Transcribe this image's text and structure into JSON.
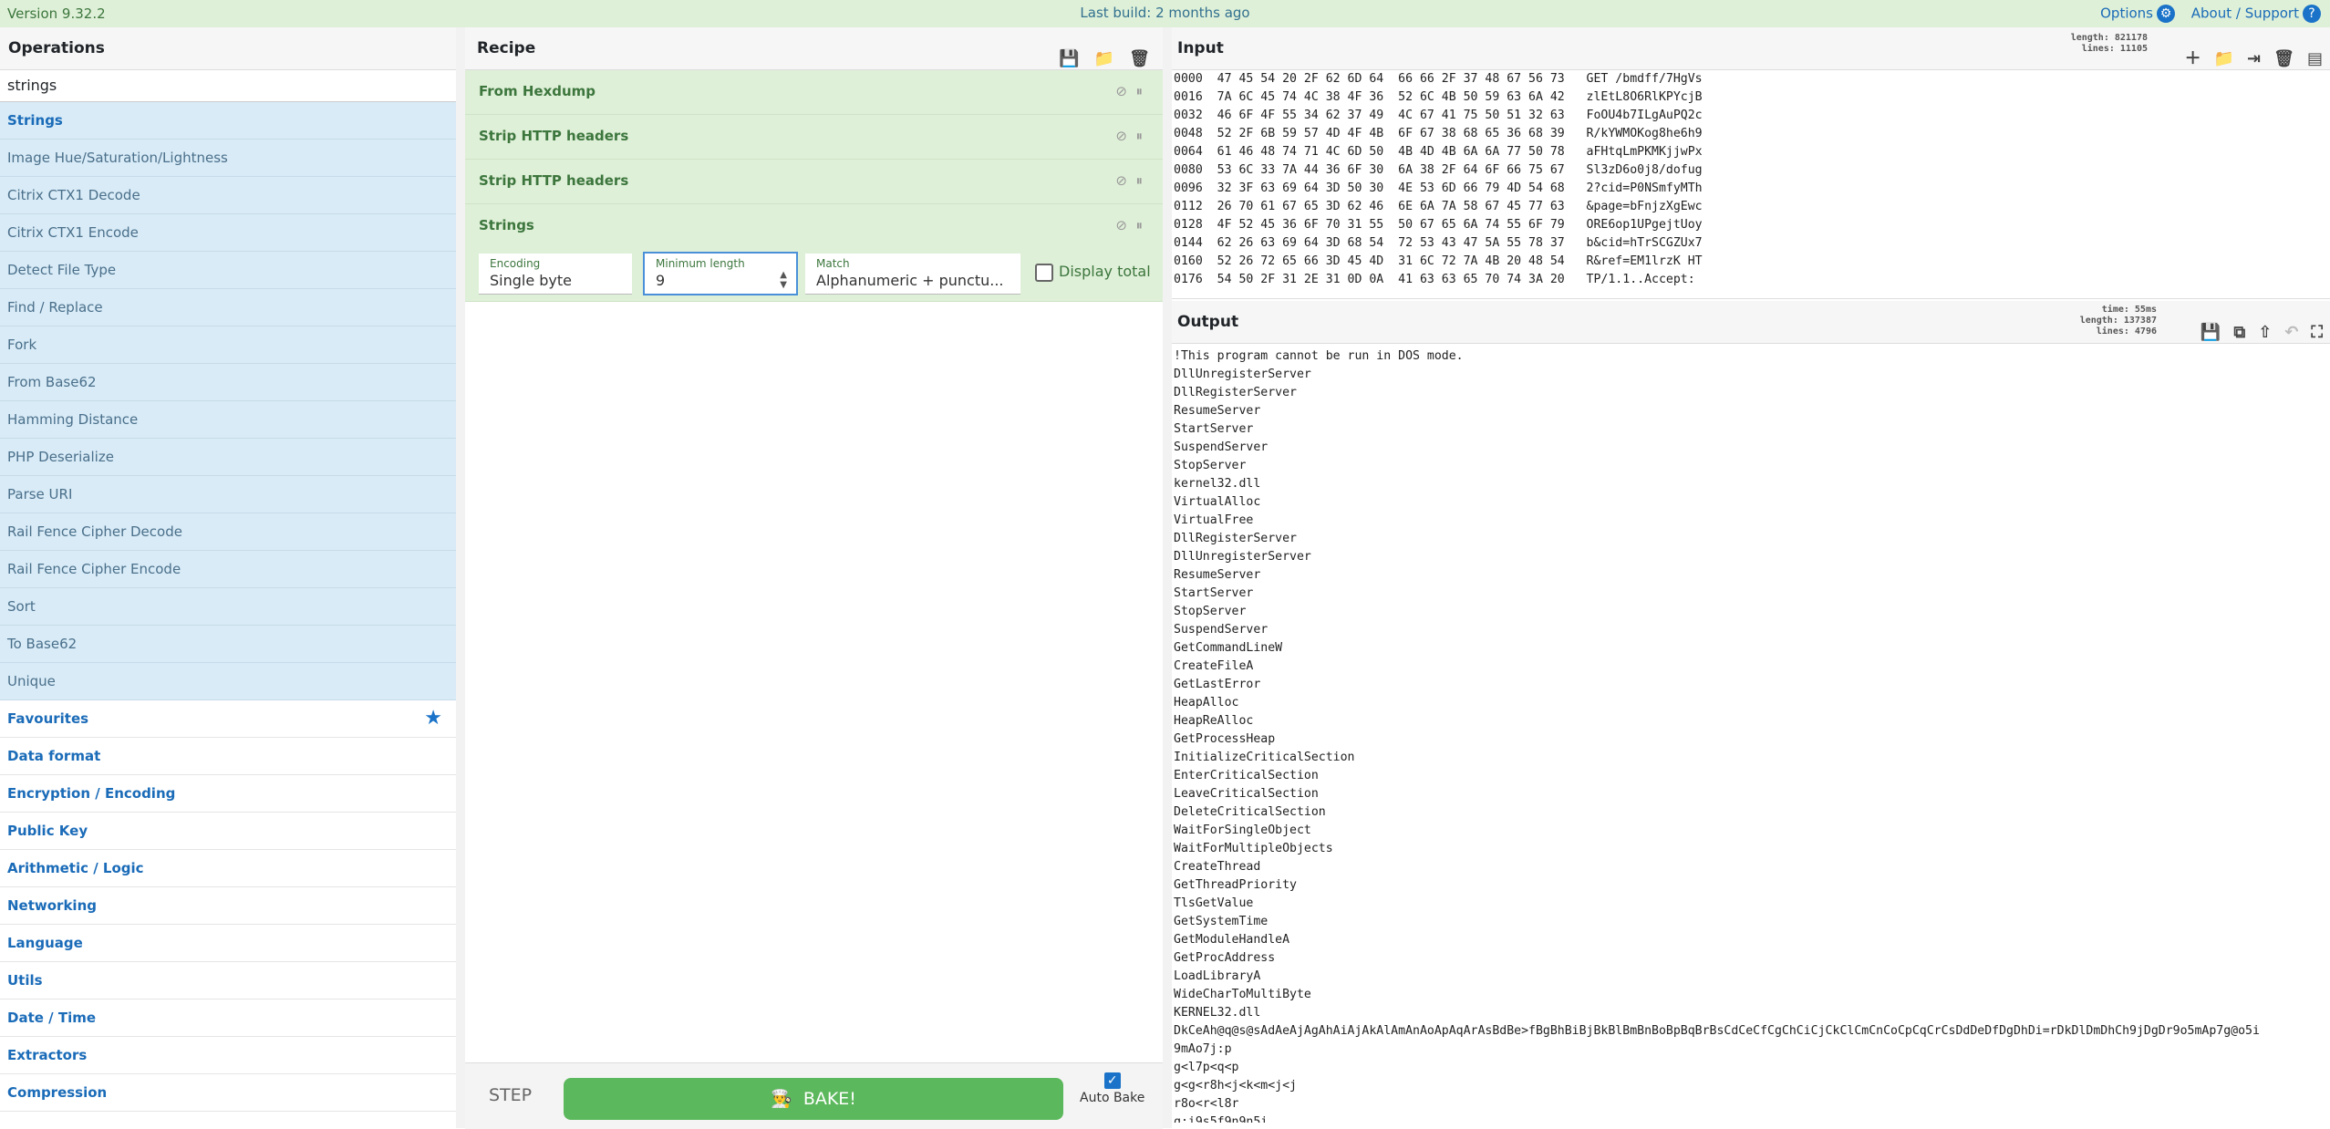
{
  "topbar": {
    "version": "Version 9.32.2",
    "build": "Last build: 2 months ago",
    "options": "Options",
    "about": "About / Support"
  },
  "operations": {
    "title": "Operations",
    "search_value": "strings",
    "results": [
      "Strings",
      "Image Hue/Saturation/Lightness",
      "Citrix CTX1 Decode",
      "Citrix CTX1 Encode",
      "Detect File Type",
      "Find / Replace",
      "Fork",
      "From Base62",
      "Hamming Distance",
      "PHP Deserialize",
      "Parse URI",
      "Rail Fence Cipher Decode",
      "Rail Fence Cipher Encode",
      "Sort",
      "To Base62",
      "Unique"
    ],
    "categories": [
      "Favourites",
      "Data format",
      "Encryption / Encoding",
      "Public Key",
      "Arithmetic / Logic",
      "Networking",
      "Language",
      "Utils",
      "Date / Time",
      "Extractors",
      "Compression"
    ]
  },
  "recipe": {
    "title": "Recipe",
    "ops": [
      "From Hexdump",
      "Strip HTTP headers",
      "Strip HTTP headers",
      "Strings"
    ],
    "strings_args": {
      "encoding_label": "Encoding",
      "encoding_value": "Single byte",
      "minlen_label": "Minimum length",
      "minlen_value": "9",
      "match_label": "Match",
      "match_value": "Alphanumeric + punctu...",
      "display_total": "Display total"
    },
    "step": "STEP",
    "bake": "BAKE!",
    "auto_bake": "Auto Bake"
  },
  "input": {
    "title": "Input",
    "length": "length: 821178",
    "lines": "lines:  11105",
    "text": "0000  47 45 54 20 2F 62 6D 64  66 66 2F 37 48 67 56 73   GET /bmdff/7HgVs\n0016  7A 6C 45 74 4C 38 4F 36  52 6C 4B 50 59 63 6A 42   zlEtL8O6RlKPYcjB\n0032  46 6F 4F 55 34 62 37 49  4C 67 41 75 50 51 32 63   FoOU4b7ILgAuPQ2c\n0048  52 2F 6B 59 57 4D 4F 4B  6F 67 38 68 65 36 68 39   R/kYWMOKog8he6h9\n0064  61 46 48 74 71 4C 6D 50  4B 4D 4B 6A 6A 77 50 78   aFHtqLmPKMKjjwPx\n0080  53 6C 33 7A 44 36 6F 30  6A 38 2F 64 6F 66 75 67   Sl3zD6o0j8/dofug\n0096  32 3F 63 69 64 3D 50 30  4E 53 6D 66 79 4D 54 68   2?cid=P0NSmfyMTh\n0112  26 70 61 67 65 3D 62 46  6E 6A 7A 58 67 45 77 63   &page=bFnjzXgEwc\n0128  4F 52 45 36 6F 70 31 55  50 67 65 6A 74 55 6F 79   ORE6op1UPgejtUoy\n0144  62 26 63 69 64 3D 68 54  72 53 43 47 5A 55 78 37   b&cid=hTrSCGZUx7\n0160  52 26 72 65 66 3D 45 4D  31 6C 72 7A 4B 20 48 54   R&ref=EM1lrzK HT\n0176  54 50 2F 31 2E 31 0D 0A  41 63 63 65 70 74 3A 20   TP/1.1..Accept: "
  },
  "output": {
    "title": "Output",
    "time": "time:   55ms",
    "length": "length: 137387",
    "lines": "lines:   4796",
    "text": "!This program cannot be run in DOS mode.\nDllUnregisterServer\nDllRegisterServer\nResumeServer\nStartServer\nSuspendServer\nStopServer\nkernel32.dll\nVirtualAlloc\nVirtualFree\nDllRegisterServer\nDllUnregisterServer\nResumeServer\nStartServer\nStopServer\nSuspendServer\nGetCommandLineW\nCreateFileA\nGetLastError\nHeapAlloc\nHeapReAlloc\nGetProcessHeap\nInitializeCriticalSection\nEnterCriticalSection\nLeaveCriticalSection\nDeleteCriticalSection\nWaitForSingleObject\nWaitForMultipleObjects\nCreateThread\nGetThreadPriority\nTlsGetValue\nGetSystemTime\nGetModuleHandleA\nGetProcAddress\nLoadLibraryA\nWideCharToMultiByte\nKERNEL32.dll\nDkCeAh@q@s@sAdAeAjAgAhAiAjAkAlAmAnAoApAqArAsBdBe>fBgBhBiBjBkBlBmBnBoBpBqBrBsCdCeCfCgChCiCjCkClCmCnCoCpCqCrCsDdDeDfDgDhDi=rDkDlDmDhCh9jDgDr9o5mAp7g@o5i\n9mAo7j:p\ng<l7p<q<p\ng<g<r8h<j<k<m<j<j\nr8o<r<l8r\nq:i9s5f9n9n5i"
  }
}
